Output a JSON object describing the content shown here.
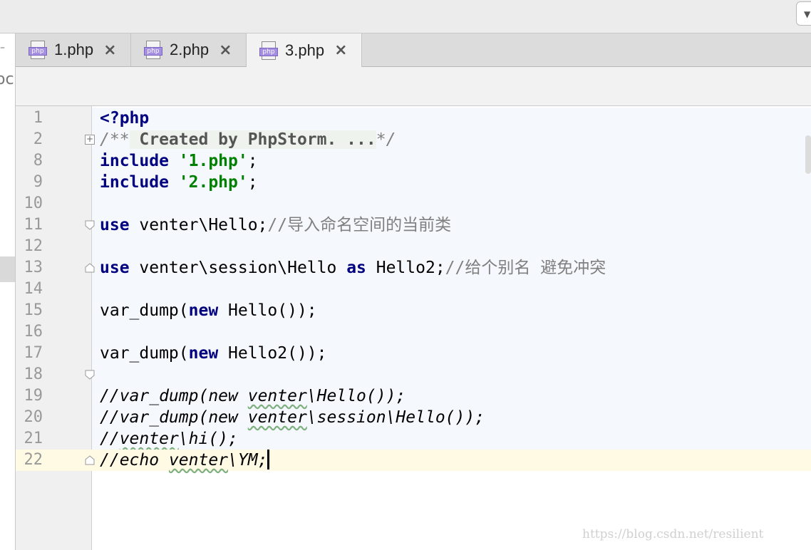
{
  "tabs": [
    {
      "label": "1.php",
      "icon": "php-file-icon",
      "active": false
    },
    {
      "label": "2.php",
      "icon": "php-file-icon",
      "active": false
    },
    {
      "label": "3.php",
      "icon": "php-file-icon",
      "active": true
    }
  ],
  "tab_icon_badge": "php",
  "left_panel_cut_text": "oc",
  "editor": {
    "lines": [
      {
        "num": "1"
      },
      {
        "num": "2"
      },
      {
        "num": "8"
      },
      {
        "num": "9"
      },
      {
        "num": "10"
      },
      {
        "num": "11"
      },
      {
        "num": "12"
      },
      {
        "num": "13"
      },
      {
        "num": "14"
      },
      {
        "num": "15"
      },
      {
        "num": "16"
      },
      {
        "num": "17"
      },
      {
        "num": "18"
      },
      {
        "num": "19"
      },
      {
        "num": "20"
      },
      {
        "num": "21"
      },
      {
        "num": "22"
      }
    ],
    "code": {
      "php_open": "<?php",
      "doc_open": "/**",
      "doc_fold": " Created by PhpStorm. ...",
      "doc_close": "*/",
      "kw_include": "include",
      "str_1": "'1.php'",
      "str_2": "'2.php'",
      "semicolon": ";",
      "kw_use": "use",
      "use1_name": " venter\\Hello;",
      "use1_comment": "//导入命名空间的当前类",
      "use2_name": " venter\\session\\Hello ",
      "kw_as": "as",
      "use2_alias": " Hello2;",
      "use2_comment": "//给个别名 避免冲突",
      "fn_var_dump": "var_dump(",
      "kw_new": "new",
      "call1_rest": " Hello());",
      "call2_rest": " Hello2());",
      "c19_a": "//var_dump(new ",
      "c19_sq": "venter",
      "c19_b": "\\Hello());",
      "c20_a": "//var_dump(new ",
      "c20_sq": "venter",
      "c20_b": "\\session\\Hello());",
      "c21_a": "//",
      "c21_sq": "venter",
      "c21_b": "\\hi();",
      "c22_a": "//echo ",
      "c22_sq": "venter",
      "c22_b": "\\YM;"
    }
  },
  "watermark": "https://blog.csdn.net/resilient",
  "colors": {
    "keyword": "#000080",
    "string": "#008000",
    "comment": "#808080",
    "current_line": "#fffae3",
    "php_badge": "#a58fe0"
  }
}
